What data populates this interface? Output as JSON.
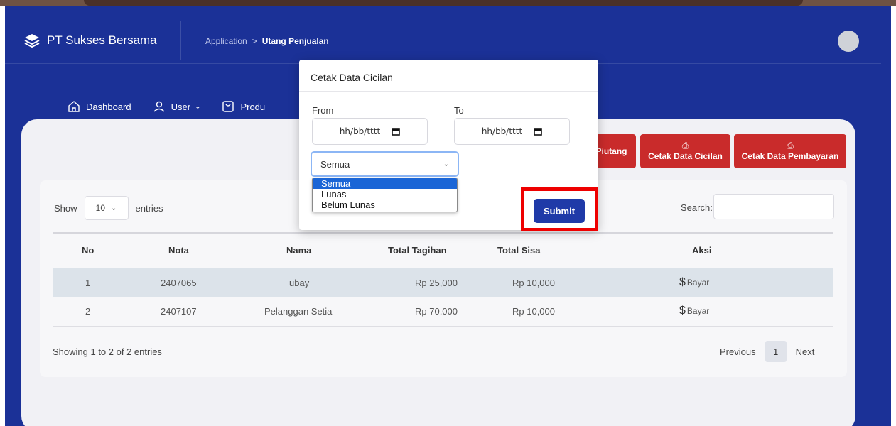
{
  "app": {
    "brand": "PT Sukses Bersama"
  },
  "breadcrumb": {
    "parent": "Application",
    "separator": ">",
    "current": "Utang Penjualan"
  },
  "nav": [
    {
      "label": "Dashboard",
      "icon": "home-icon"
    },
    {
      "label": "User",
      "icon": "user-icon"
    },
    {
      "label": "Produ",
      "icon": "box-icon"
    }
  ],
  "actions": [
    {
      "label": "Piutang"
    },
    {
      "label": "Cetak Data Cicilan",
      "icon": "printer-icon"
    },
    {
      "label": "Cetak Data Pembayaran",
      "icon": "printer-icon"
    }
  ],
  "table": {
    "show_label": "Show",
    "entries_label": "entries",
    "page_length": "10",
    "search_label": "Search:",
    "columns": [
      "No",
      "Nota",
      "Nama",
      "Total Tagihan",
      "Total Sisa",
      "Aksi"
    ],
    "rows": [
      {
        "no": "1",
        "nota": "2407065",
        "nama": "ubay",
        "tagihan": "Rp 25,000",
        "sisa": "Rp 10,000",
        "aksi": "Bayar"
      },
      {
        "no": "2",
        "nota": "2407107",
        "nama": "Pelanggan Setia",
        "tagihan": "Rp 70,000",
        "sisa": "Rp 10,000",
        "aksi": "Bayar"
      }
    ],
    "info": "Showing 1 to 2 of 2 entries",
    "pager": {
      "previous": "Previous",
      "page": "1",
      "next": "Next"
    }
  },
  "modal": {
    "title": "Cetak Data Cicilan",
    "from_label": "From",
    "to_label": "To",
    "from_value": "hh/bb/tttt",
    "to_value": "hh/bb/tttt",
    "status_value": "Semua",
    "status_options": [
      "Semua",
      "Lunas",
      "Belum Lunas"
    ],
    "submit_label": "Submit"
  },
  "colors": {
    "primary": "#1b3197",
    "danger": "#c92b2b",
    "submit": "#1f3aa8",
    "highlight": "#ee0000"
  }
}
